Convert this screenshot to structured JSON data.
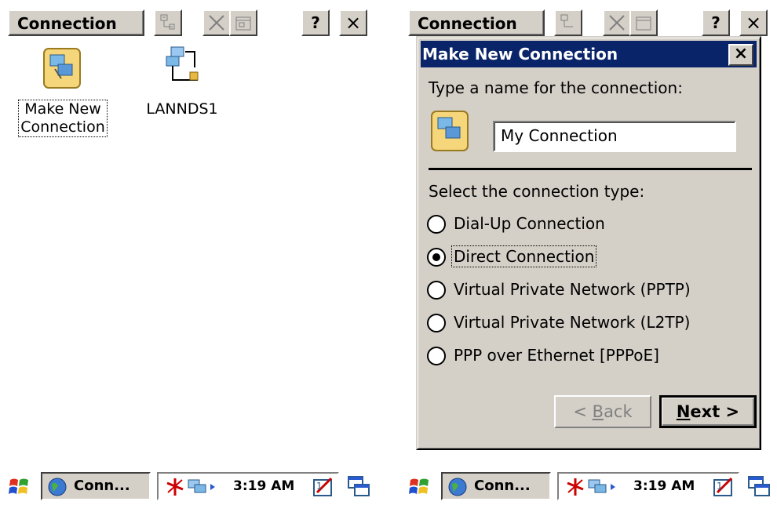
{
  "left": {
    "menu_label": "Connection",
    "toolbar": {
      "help_label": "?",
      "close_label": "×"
    },
    "icons": [
      {
        "label_line1": "Make New",
        "label_line2": "Connection",
        "icon": "make-new-connection-icon"
      },
      {
        "label_line1": "LANNDS1",
        "icon": "network-connection-icon"
      }
    ],
    "taskbar": {
      "app_label": "Conn...",
      "time": "3:19 AM"
    }
  },
  "right": {
    "menu_label": "Connection",
    "toolbar": {
      "help_label": "?",
      "close_label": "×"
    },
    "dialog": {
      "title": "Make New Connection",
      "close_label": "×",
      "name_prompt": "Type a name for the connection:",
      "name_value": "My Connection",
      "type_prompt": "Select the connection type:",
      "options": [
        {
          "label": "Dial-Up Connection",
          "checked": false
        },
        {
          "label": "Direct Connection",
          "checked": true
        },
        {
          "label": "Virtual Private Network (PPTP)",
          "checked": false
        },
        {
          "label": "Virtual Private Network (L2TP)",
          "checked": false
        },
        {
          "label": "PPP over Ethernet [PPPoE]",
          "checked": false
        }
      ],
      "back_label_pre": "< ",
      "back_label_key": "B",
      "back_label_post": "ack",
      "next_label_key": "N",
      "next_label_post": "ext >"
    },
    "taskbar": {
      "app_label": "Conn...",
      "time": "3:19 AM"
    }
  },
  "colors": {
    "title_bar": "#0a246a",
    "button_face": "#d4d0c8"
  }
}
